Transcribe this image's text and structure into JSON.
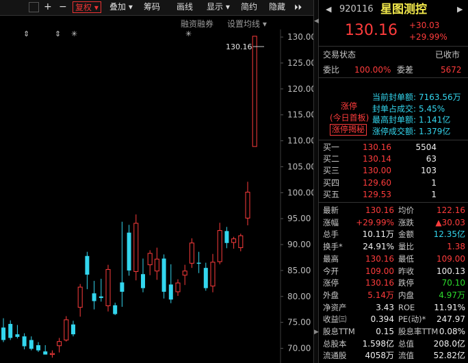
{
  "toolbar": {
    "grid_icon": "grid-icon",
    "plus": "+",
    "minus": "−",
    "fuquan": "复权 ▾",
    "diejia": "叠加 ▾",
    "chouma": "筹码",
    "huaxian": "画线",
    "xianshi": "显示 ▾",
    "jianyue": "简约",
    "yincang": "隐藏",
    "more": "⏵⏵"
  },
  "subbar": {
    "margin": "融资融券",
    "set_ma": "设置均线 ▾",
    "markers": [
      "⇕",
      "⇕",
      "✳",
      "✳"
    ]
  },
  "chart_data": {
    "type": "candlestick",
    "y_axis_ticks": [
      130.0,
      125.0,
      120.0,
      115.0,
      110.0,
      105.0,
      100.0,
      95.0,
      90.0,
      85.0,
      80.0,
      75.0,
      70.0
    ],
    "ylim": [
      67.3,
      131.2
    ],
    "last_price_label": "130.16",
    "up_color": "#ff3c3c",
    "down_color": "#33d6ee",
    "candles": [
      {
        "o": 74.0,
        "h": 75.8,
        "l": 71.2,
        "c": 71.6
      },
      {
        "o": 74.7,
        "h": 75.4,
        "l": 71.6,
        "c": 72.0
      },
      {
        "o": 72.7,
        "h": 74.5,
        "l": 71.9,
        "c": 72.2
      },
      {
        "o": 72.3,
        "h": 72.9,
        "l": 69.8,
        "c": 70.4
      },
      {
        "o": 71.6,
        "h": 72.3,
        "l": 69.6,
        "c": 69.9
      },
      {
        "o": 70.6,
        "h": 71.2,
        "l": 69.3,
        "c": 69.6
      },
      {
        "o": 69.4,
        "h": 70.6,
        "l": 68.8,
        "c": 68.8
      },
      {
        "o": 68.8,
        "h": 69.6,
        "l": 68.2,
        "c": 69.0
      },
      {
        "o": 70.5,
        "h": 72.0,
        "l": 69.2,
        "c": 71.3
      },
      {
        "o": 71.6,
        "h": 76.2,
        "l": 71.3,
        "c": 75.5
      },
      {
        "o": 74.6,
        "h": 75.3,
        "l": 72.3,
        "c": 72.7
      },
      {
        "o": 77.9,
        "h": 82.4,
        "l": 76.1,
        "c": 81.8
      },
      {
        "o": 87.8,
        "h": 88.6,
        "l": 81.4,
        "c": 84.2
      },
      {
        "o": 80.6,
        "h": 83.0,
        "l": 77.5,
        "c": 79.1
      },
      {
        "o": 80.0,
        "h": 83.4,
        "l": 79.0,
        "c": 79.7
      },
      {
        "o": 78.2,
        "h": 86.1,
        "l": 77.1,
        "c": 85.2
      },
      {
        "o": 78.3,
        "h": 78.8,
        "l": 76.4,
        "c": 76.6
      },
      {
        "o": 82.7,
        "h": 94.4,
        "l": 78.0,
        "c": 80.9
      },
      {
        "o": 92.3,
        "h": 93.8,
        "l": 84.0,
        "c": 85.0
      },
      {
        "o": 84.8,
        "h": 95.8,
        "l": 83.1,
        "c": 94.1
      },
      {
        "o": 84.3,
        "h": 87.3,
        "l": 80.8,
        "c": 81.6
      },
      {
        "o": 86.1,
        "h": 88.9,
        "l": 84.1,
        "c": 88.3
      },
      {
        "o": 84.9,
        "h": 89.4,
        "l": 83.2,
        "c": 87.2
      },
      {
        "o": 87.3,
        "h": 88.1,
        "l": 79.6,
        "c": 80.9
      },
      {
        "o": 82.3,
        "h": 86.2,
        "l": 78.7,
        "c": 79.4
      },
      {
        "o": 80.9,
        "h": 83.3,
        "l": 80.1,
        "c": 82.6
      },
      {
        "o": 84.1,
        "h": 86.1,
        "l": 82.2,
        "c": 84.9
      },
      {
        "o": 86.4,
        "h": 91.2,
        "l": 85.5,
        "c": 90.3
      },
      {
        "o": 86.5,
        "h": 88.6,
        "l": 84.5,
        "c": 86.3
      },
      {
        "o": 85.5,
        "h": 86.5,
        "l": 81.1,
        "c": 81.6
      },
      {
        "o": 82.0,
        "h": 88.2,
        "l": 80.8,
        "c": 86.6
      },
      {
        "o": 86.7,
        "h": 94.2,
        "l": 86.2,
        "c": 92.7
      },
      {
        "o": 92.6,
        "h": 93.4,
        "l": 89.3,
        "c": 90.3
      },
      {
        "o": 90.4,
        "h": 91.5,
        "l": 89.2,
        "c": 91.1
      },
      {
        "o": 89.4,
        "h": 92.1,
        "l": 88.7,
        "c": 91.7
      },
      {
        "o": 95.1,
        "h": 102.1,
        "l": 93.7,
        "c": 100.1
      },
      {
        "o": 108.9,
        "h": 130.16,
        "l": 108.9,
        "c": 130.16
      }
    ]
  },
  "quote": {
    "code": "920116",
    "name": "星图测控",
    "price": "130.16",
    "change": "+30.03",
    "change_pct": "+29.99%",
    "nav_left": "◀",
    "nav_right": "▶"
  },
  "status": {
    "label": "交易状态",
    "value": "已收市",
    "weibi_label": "委比",
    "weibi_value": "100.00%",
    "weicha_label": "委差",
    "weicha_value": "5672"
  },
  "limit_up": {
    "badge_line1": "涨停",
    "badge_line2": "(今日首板)",
    "reveal_button": "涨停揭秘",
    "rows": [
      {
        "label": "当前封单额:",
        "value": "7163.56万"
      },
      {
        "label": "封单占成交:",
        "value": "5.45%"
      },
      {
        "label": "最高封单额:",
        "value": "1.141亿"
      },
      {
        "label": "涨停成交额:",
        "value": "1.379亿"
      }
    ]
  },
  "bids": [
    {
      "label": "买一",
      "price": "130.16",
      "vol": "5504"
    },
    {
      "label": "买二",
      "price": "130.14",
      "vol": "63"
    },
    {
      "label": "买三",
      "price": "130.00",
      "vol": "103"
    },
    {
      "label": "买四",
      "price": "129.60",
      "vol": "1"
    },
    {
      "label": "买五",
      "price": "129.53",
      "vol": "1"
    }
  ],
  "stats": [
    {
      "l1": "最新",
      "v1": "130.16",
      "c1": "red",
      "l2": "均价",
      "v2": "122.16",
      "c2": "red"
    },
    {
      "l1": "涨幅",
      "v1": "+29.99%",
      "c1": "red",
      "l2": "涨跌",
      "v2": "▲30.03",
      "c2": "red"
    },
    {
      "l1": "总手",
      "v1": "10.11万",
      "c1": "white",
      "l2": "金额",
      "v2": "12.35亿",
      "c2": "cyan"
    },
    {
      "l1": "换手*",
      "v1": "24.91%",
      "c1": "white",
      "l2": "量比",
      "v2": "1.38",
      "c2": "red"
    },
    {
      "l1": "最高",
      "v1": "130.16",
      "c1": "red",
      "l2": "最低",
      "v2": "109.00",
      "c2": "red"
    },
    {
      "l1": "今开",
      "v1": "109.00",
      "c1": "red",
      "l2": "昨收",
      "v2": "100.13",
      "c2": "white"
    },
    {
      "l1": "涨停",
      "v1": "130.16",
      "c1": "red",
      "l2": "跌停",
      "v2": "70.10",
      "c2": "green"
    },
    {
      "l1": "外盘",
      "v1": "5.14万",
      "c1": "red",
      "l2": "内盘",
      "v2": "4.97万",
      "c2": "green"
    },
    {
      "l1": "净资产",
      "v1": "3.43",
      "c1": "white",
      "l2": "ROE",
      "v2": "11.91%",
      "c2": "white"
    },
    {
      "l1": "收益㈢",
      "v1": "0.394",
      "c1": "white",
      "l2": "PE(动)*",
      "v2": "247.97",
      "c2": "white"
    },
    {
      "l1": "股息TTM",
      "v1": "0.15",
      "c1": "white",
      "l2": "股息率TTM",
      "v2": "0.08%",
      "c2": "white"
    },
    {
      "l1": "总股本",
      "v1": "1.598亿",
      "c1": "white",
      "l2": "总值",
      "v2": "208.0亿",
      "c2": "white"
    },
    {
      "l1": "流通股",
      "v1": "4058万",
      "c1": "white",
      "l2": "流值",
      "v2": "52.82亿",
      "c2": "white"
    }
  ]
}
